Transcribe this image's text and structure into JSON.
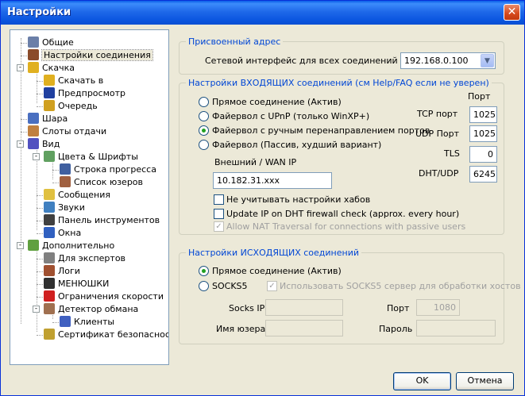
{
  "window": {
    "title": "Настройки",
    "close_glyph": "✕"
  },
  "tree": {
    "items": [
      {
        "label": "Общие",
        "icon": "users-icon",
        "color": "#6b7fa8"
      },
      {
        "label": "Настройки соединения",
        "icon": "connection-icon",
        "color": "#8a4b2a",
        "selected": true
      },
      {
        "label": "Скачка",
        "icon": "download-icon",
        "color": "#e0b020"
      },
      {
        "label": "Скачать в",
        "icon": "download-to-icon",
        "color": "#e0b020"
      },
      {
        "label": "Предпросмотр",
        "icon": "preview-icon",
        "color": "#2040a0"
      },
      {
        "label": "Очередь",
        "icon": "queue-icon",
        "color": "#d0a020"
      },
      {
        "label": "Шара",
        "icon": "share-icon",
        "color": "#4a6fc0"
      },
      {
        "label": "Слоты отдачи",
        "icon": "slots-icon",
        "color": "#c08040"
      },
      {
        "label": "Вид",
        "icon": "view-icon",
        "color": "#5050c0"
      },
      {
        "label": "Цвета & Шрифты",
        "icon": "colors-icon",
        "color": "#60a060"
      },
      {
        "label": "Строка прогресса",
        "icon": "progress-icon",
        "color": "#4060a0"
      },
      {
        "label": "Список юзеров",
        "icon": "userlist-icon",
        "color": "#a06040"
      },
      {
        "label": "Сообщения",
        "icon": "messages-icon",
        "color": "#e0c040"
      },
      {
        "label": "Звуки",
        "icon": "sounds-icon",
        "color": "#4080c0"
      },
      {
        "label": "Панель инструментов",
        "icon": "toolbar-icon",
        "color": "#404040"
      },
      {
        "label": "Окна",
        "icon": "windows-icon",
        "color": "#3060c0"
      },
      {
        "label": "Дополнительно",
        "icon": "advanced-icon",
        "color": "#60a040"
      },
      {
        "label": "Для экспертов",
        "icon": "experts-icon",
        "color": "#808080"
      },
      {
        "label": "Логи",
        "icon": "logs-icon",
        "color": "#a05030"
      },
      {
        "label": "МЕНЮШКИ",
        "icon": "menus-icon",
        "color": "#303030"
      },
      {
        "label": "Ограничения скорости",
        "icon": "speed-limit-icon",
        "color": "#d02020"
      },
      {
        "label": "Детектор обмана",
        "icon": "detector-icon",
        "color": "#a07050"
      },
      {
        "label": "Клиенты",
        "icon": "clients-icon",
        "color": "#4060c0"
      },
      {
        "label": "Сертификат безопасности",
        "icon": "certificate-icon",
        "color": "#c0a030"
      }
    ]
  },
  "assigned": {
    "legend": "Присвоенный адрес",
    "iface_label": "Сетевой интерфейс для всех соединений",
    "iface_value": "192.168.0.100"
  },
  "incoming": {
    "legend": "Настройки ВХОДЯЩИХ соединений (см Help/FAQ если не уверен)",
    "port_header": "Порт",
    "options": [
      "Прямое соединение (Актив)",
      "Файервол с UPnP (только WinXP+)",
      "Файервол с ручным перенаправлением портов",
      "Файервол (Пассив, худший вариант)"
    ],
    "selected": 2,
    "tcp_label": "TCP порт",
    "tcp_value": "1025",
    "udp_label": "UDP Порт",
    "udp_value": "1025",
    "tls_label": "TLS",
    "tls_value": "0",
    "dht_label": "DHT/UDP",
    "dht_value": "6245",
    "wan_label": "Внешний / WAN IP",
    "wan_value": "10.182.31.xxx",
    "chk_hubs": "Не учитывать настройки хабов",
    "chk_dht": "Update IP on DHT firewall check (approx. every hour)",
    "chk_nat": "Allow NAT Traversal for connections with passive users"
  },
  "outgoing": {
    "legend": "Настройки ИСХОДЯЩИХ соединений",
    "direct": "Прямое соединение (Актив)",
    "socks": "SOCKS5",
    "chk_socks": "Использовать SOCKS5 сервер для обработки хостов",
    "socks_ip_label": "Socks IP",
    "port_label": "Порт",
    "port_value": "1080",
    "user_label": "Имя юзера",
    "pass_label": "Пароль"
  },
  "buttons": {
    "ok": "OK",
    "cancel": "Отмена"
  }
}
